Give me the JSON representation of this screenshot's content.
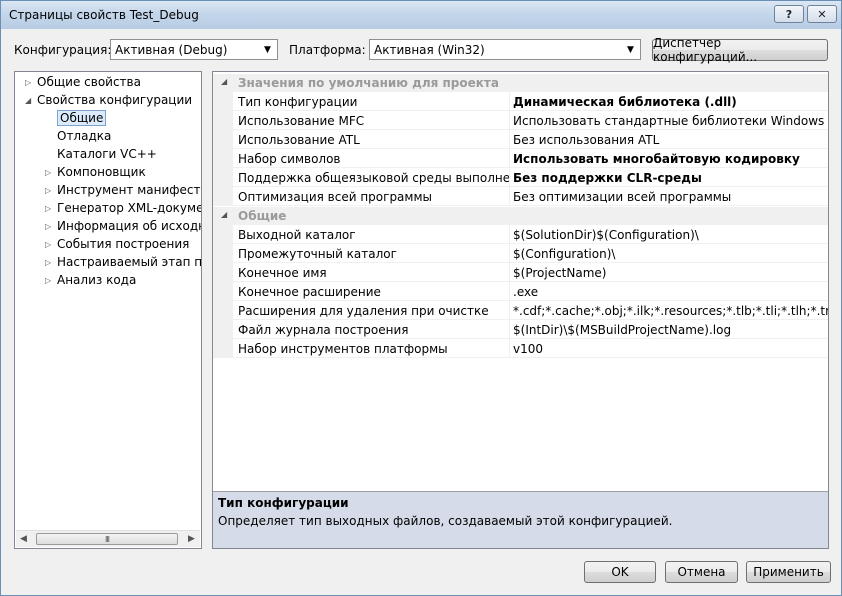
{
  "window": {
    "title": "Страницы свойств Test_Debug",
    "help_label": "?",
    "close_label": "✕"
  },
  "toolbar": {
    "config_label": "Конфигурация:",
    "config_value": "Активная (Debug)",
    "platform_label": "Платформа:",
    "platform_value": "Активная (Win32)",
    "config_manager_label": "Диспетчер конфигураций..."
  },
  "tree": {
    "items": [
      {
        "label": "Общие свойства",
        "expander": "▷"
      },
      {
        "label": "Свойства конфигурации",
        "expander": "◢"
      },
      {
        "label": "Общие",
        "expander": ""
      },
      {
        "label": "Отладка",
        "expander": ""
      },
      {
        "label": "Каталоги VC++",
        "expander": ""
      },
      {
        "label": "Компоновщик",
        "expander": "▷"
      },
      {
        "label": "Инструмент манифеста",
        "expander": "▷"
      },
      {
        "label": "Генератор XML-документ",
        "expander": "▷"
      },
      {
        "label": "Информация об исходно",
        "expander": "▷"
      },
      {
        "label": "События построения",
        "expander": "▷"
      },
      {
        "label": "Настраиваемый этап пос",
        "expander": "▷"
      },
      {
        "label": "Анализ кода",
        "expander": "▷"
      }
    ],
    "scroll_left": "◀",
    "scroll_right": "▶",
    "scroll_grip": "III"
  },
  "grid": {
    "categories": [
      {
        "label": "Значения по умолчанию для проекта",
        "expander": "◢"
      },
      {
        "label": "Общие",
        "expander": "◢"
      }
    ],
    "rows": [
      {
        "name": "Тип конфигурации",
        "value": "Динамическая библиотека (.dll)"
      },
      {
        "name": "Использование MFC",
        "value": "Использовать стандартные библиотеки Windows"
      },
      {
        "name": "Использование ATL",
        "value": "Без использования ATL"
      },
      {
        "name": "Набор символов",
        "value": "Использовать многобайтовую кодировку"
      },
      {
        "name": "Поддержка общеязыковой среды выполнения (CLR)",
        "value": "Без поддержки CLR-среды"
      },
      {
        "name": "Оптимизация всей программы",
        "value": "Без оптимизации всей программы"
      },
      {
        "name": "Выходной каталог",
        "value": "$(SolutionDir)$(Configuration)\\"
      },
      {
        "name": "Промежуточный каталог",
        "value": "$(Configuration)\\"
      },
      {
        "name": "Конечное имя",
        "value": "$(ProjectName)"
      },
      {
        "name": "Конечное расширение",
        "value": ".exe"
      },
      {
        "name": "Расширения для удаления при очистке",
        "value": "*.cdf;*.cache;*.obj;*.ilk;*.resources;*.tlb;*.tli;*.tlh;*.tmp;*.rsp;*"
      },
      {
        "name": "Файл журнала построения",
        "value": "$(IntDir)\\$(MSBuildProjectName).log"
      },
      {
        "name": "Набор инструментов платформы",
        "value": "v100"
      }
    ]
  },
  "description": {
    "title": "Тип конфигурации",
    "text": "Определяет тип выходных файлов, создаваемый этой конфигурацией."
  },
  "buttons": {
    "ok": "OK",
    "cancel": "Отмена",
    "apply": "Применить"
  }
}
